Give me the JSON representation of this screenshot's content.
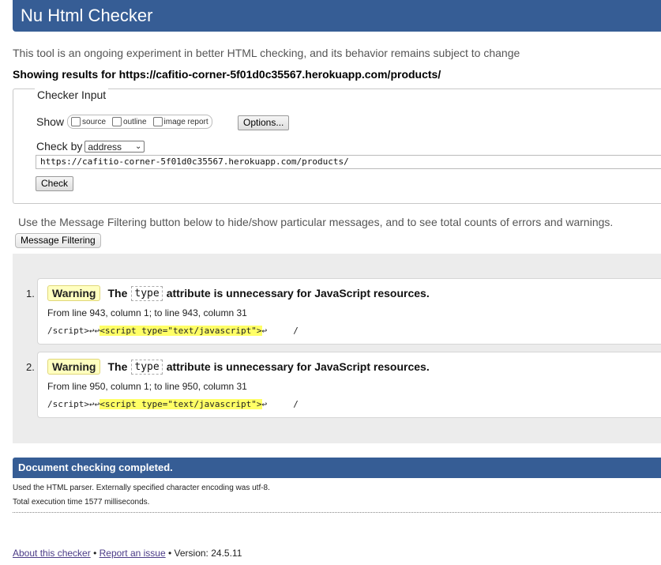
{
  "header": {
    "title": "Nu Html Checker"
  },
  "intro": "This tool is an ongoing experiment in better HTML checking, and its behavior remains subject to change",
  "showing": "Showing results for https://cafitio-corner-5f01d0c35567.herokuapp.com/products/",
  "checker_input": {
    "legend": "Checker Input",
    "show_label": "Show",
    "options": [
      "source",
      "outline",
      "image report"
    ],
    "options_button": "Options...",
    "check_by_label": "Check by",
    "check_by_value": "address",
    "url_value": "https://cafitio-corner-5f01d0c35567.herokuapp.com/products/",
    "check_button": "Check"
  },
  "filter": {
    "hint": "Use the Message Filtering button below to hide/show particular messages, and to see total counts of errors and warnings.",
    "button": "Message Filtering"
  },
  "messages": [
    {
      "num": "1.",
      "badge": "Warning",
      "pre": "The",
      "code": "type",
      "post": "attribute is unnecessary for JavaScript resources.",
      "location": "From line 943, column 1; to line 943, column 31",
      "ext_before": "/script>↩↩",
      "ext_highlight": "<script type=\"text/javascript\">",
      "ext_after": "↩     /"
    },
    {
      "num": "2.",
      "badge": "Warning",
      "pre": "The",
      "code": "type",
      "post": "attribute is unnecessary for JavaScript resources.",
      "location": "From line 950, column 1; to line 950, column 31",
      "ext_before": "/script>↩↩",
      "ext_highlight": "<script type=\"text/javascript\">",
      "ext_after": "↩     /"
    }
  ],
  "completion": {
    "title": "Document checking completed.",
    "details": [
      "Used the HTML parser. Externally specified character encoding was utf-8.",
      "Total execution time 1577 milliseconds."
    ]
  },
  "footer": {
    "about": "About this checker",
    "sep": "•",
    "report": "Report an issue",
    "version": "• Version: 24.5.11"
  },
  "colors": {
    "header_bg": "#365d95",
    "badge_bg": "#ffffc0",
    "highlight": "#ffff66"
  }
}
